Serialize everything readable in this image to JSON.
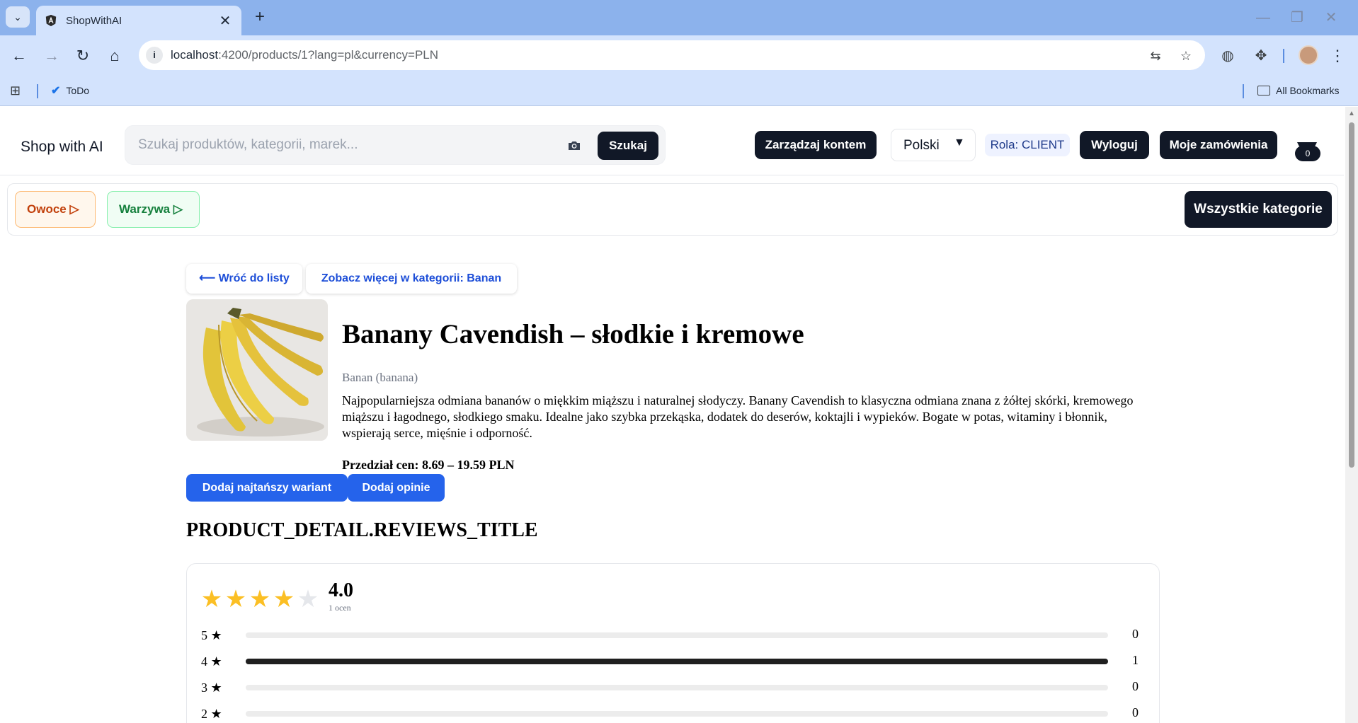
{
  "browser": {
    "tab_title": "ShopWithAI",
    "url_host": "localhost",
    "url_rest": ":4200/products/1?lang=pl&currency=PLN",
    "bookmarks": [
      {
        "label": "ToDo"
      }
    ],
    "all_bookmarks_label": "All Bookmarks"
  },
  "header": {
    "brand": "Shop with AI",
    "search_placeholder": "Szukaj produktów, kategorii, marek...",
    "search_button": "Szukaj",
    "manage_account": "Zarządzaj kontem",
    "language": "Polski",
    "role": "Rola: CLIENT",
    "logout": "Wyloguj",
    "my_orders": "Moje zamówienia",
    "cart_count": "0"
  },
  "categories": {
    "chips": [
      {
        "label": "Owoce ▷"
      },
      {
        "label": "Warzywa ▷"
      }
    ],
    "all_categories": "Wszystkie kategorie"
  },
  "product": {
    "back_link": "⟵ Wróć do listy",
    "category_link": "Zobacz więcej w kategorii: Banan",
    "title": "Banany Cavendish – słodkie i kremowe",
    "subtitle": "Banan (banana)",
    "description": "Najpopularniejsza odmiana bananów o miękkim miąższu i naturalnej słodyczy. Banany Cavendish to klasyczna odmiana znana z żółtej skórki, kremowego miąższu i łagodnego, słodkiego smaku. Idealne jako szybka przekąska, dodatek do deserów, koktajli i wypieków. Bogate w potas, witaminy i błonnik, wspierają serce, mięśnie i odporność.",
    "price_range": "Przedział cen: 8.69 – 19.59 PLN",
    "add_cheapest": "Dodaj najtańszy wariant",
    "add_review": "Dodaj opinie"
  },
  "reviews": {
    "title": "PRODUCT_DETAIL.REVIEWS_TITLE",
    "rating": 4,
    "average": "4.0",
    "count_label": "1 ocen",
    "distribution": [
      {
        "label": "5 ★",
        "count": "0",
        "fraction": 0
      },
      {
        "label": "4 ★",
        "count": "1",
        "fraction": 1
      },
      {
        "label": "3 ★",
        "count": "0",
        "fraction": 0
      },
      {
        "label": "2 ★",
        "count": "0",
        "fraction": 0
      }
    ]
  },
  "colors": {
    "accent_dark": "#111827",
    "primary_blue": "#2563eb",
    "star": "#fbbf24",
    "browser_frame": "#8cb2ec"
  }
}
